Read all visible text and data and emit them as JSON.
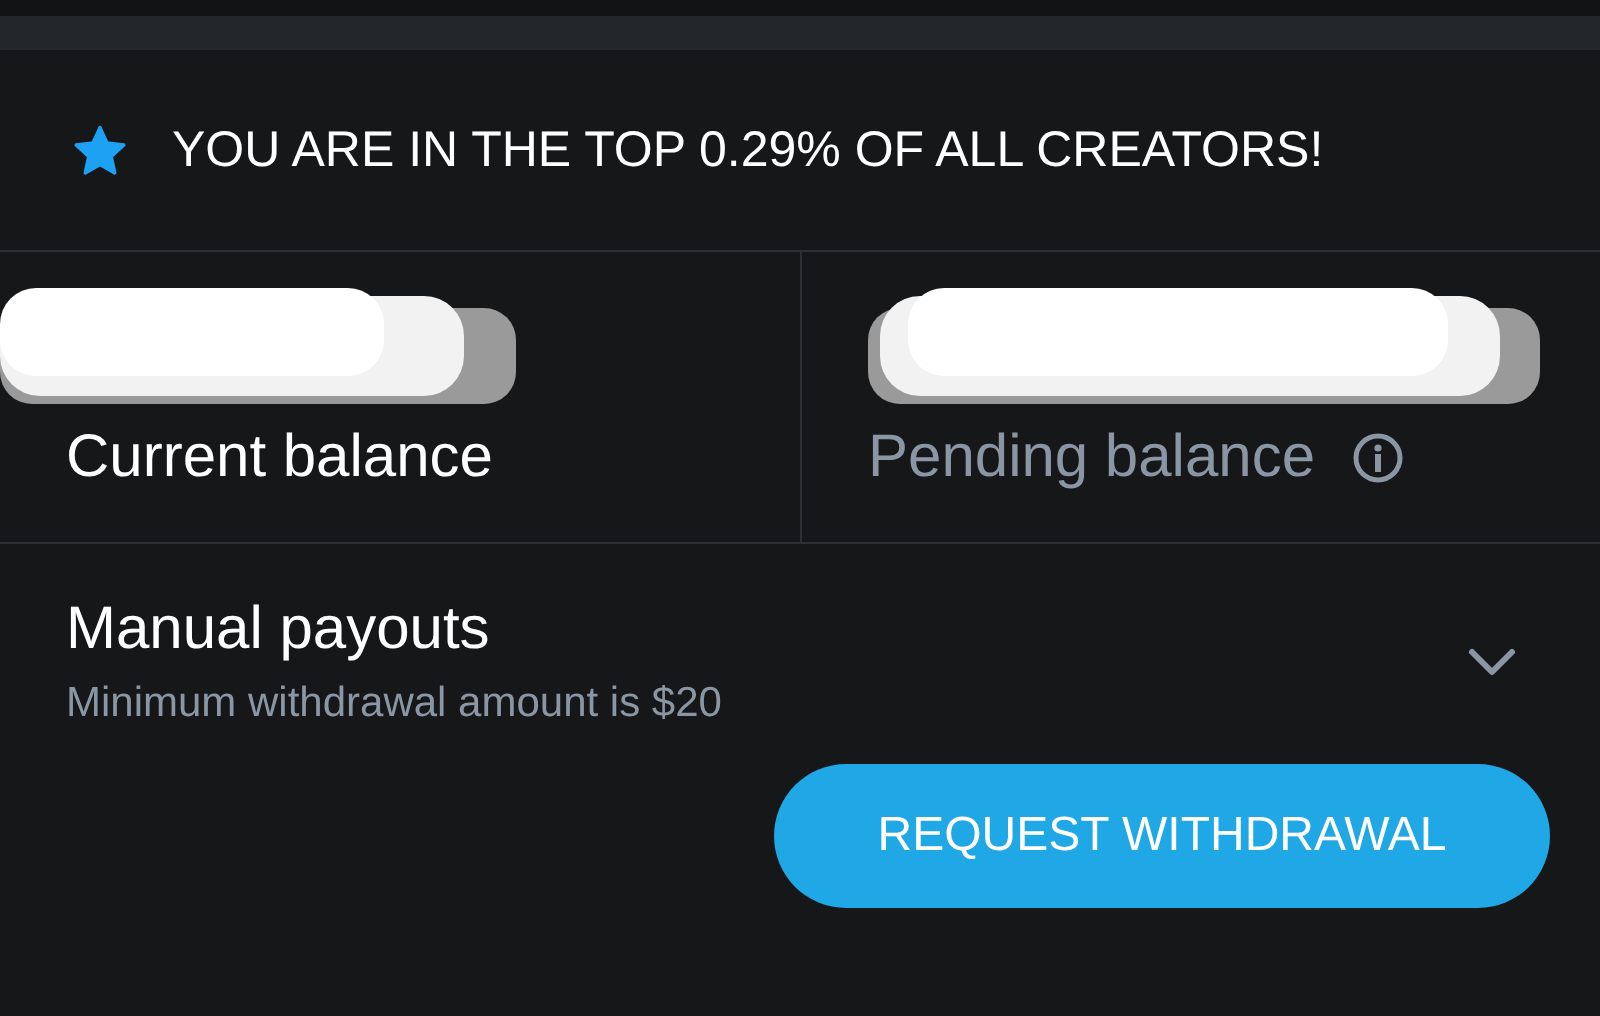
{
  "banner": {
    "text": "YOU ARE IN THE TOP 0.29% OF ALL CREATORS!"
  },
  "balances": [
    {
      "label": "Current balance",
      "muted": false,
      "info": false,
      "redacted": true
    },
    {
      "label": "Pending balance",
      "muted": true,
      "info": true,
      "redacted": true
    }
  ],
  "payouts": {
    "title": "Manual payouts",
    "subtitle": "Minimum withdrawal amount is $20",
    "expanded": false
  },
  "button": {
    "label": "REQUEST WITHDRAWAL"
  }
}
